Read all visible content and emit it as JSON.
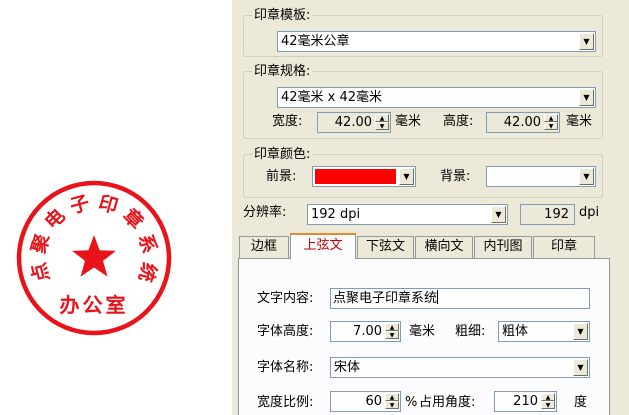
{
  "stamp": {
    "arc_text": "点聚电子印章系统",
    "bottom_text": "办公室",
    "color": "#e8141a"
  },
  "template": {
    "title": "印章模板:",
    "value": "42毫米公章"
  },
  "spec": {
    "title": "印章规格:",
    "value": "42毫米 x 42毫米",
    "width_label": "宽度:",
    "width_value": "42.00",
    "height_label": "高度:",
    "height_value": "42.00",
    "unit": "毫米"
  },
  "color": {
    "title": "印章颜色:",
    "foreground_label": "前景:",
    "foreground_color": "#ff0000",
    "background_label": "背景:",
    "background_color": "#ffffff"
  },
  "resolution": {
    "label": "分辨率:",
    "value": "192 dpi",
    "number": "192",
    "unit": "dpi"
  },
  "tabs": [
    "边框",
    "上弦文",
    "下弦文",
    "横向文",
    "内刊图",
    "印章"
  ],
  "active_tab": "上弦文",
  "upper_text": {
    "content_label": "文字内容:",
    "content_value": "点聚电子印章系统",
    "font_height_label": "字体高度:",
    "font_height_value": "7.00",
    "font_height_unit": "毫米",
    "weight_label": "粗细:",
    "weight_value": "粗体",
    "font_name_label": "字体名称:",
    "font_name_value": "宋体",
    "width_ratio_label": "宽度比例:",
    "width_ratio_value": "60",
    "width_ratio_unit": "%",
    "angle_label": "占用角度:",
    "angle_value": "210",
    "angle_unit": "度"
  }
}
